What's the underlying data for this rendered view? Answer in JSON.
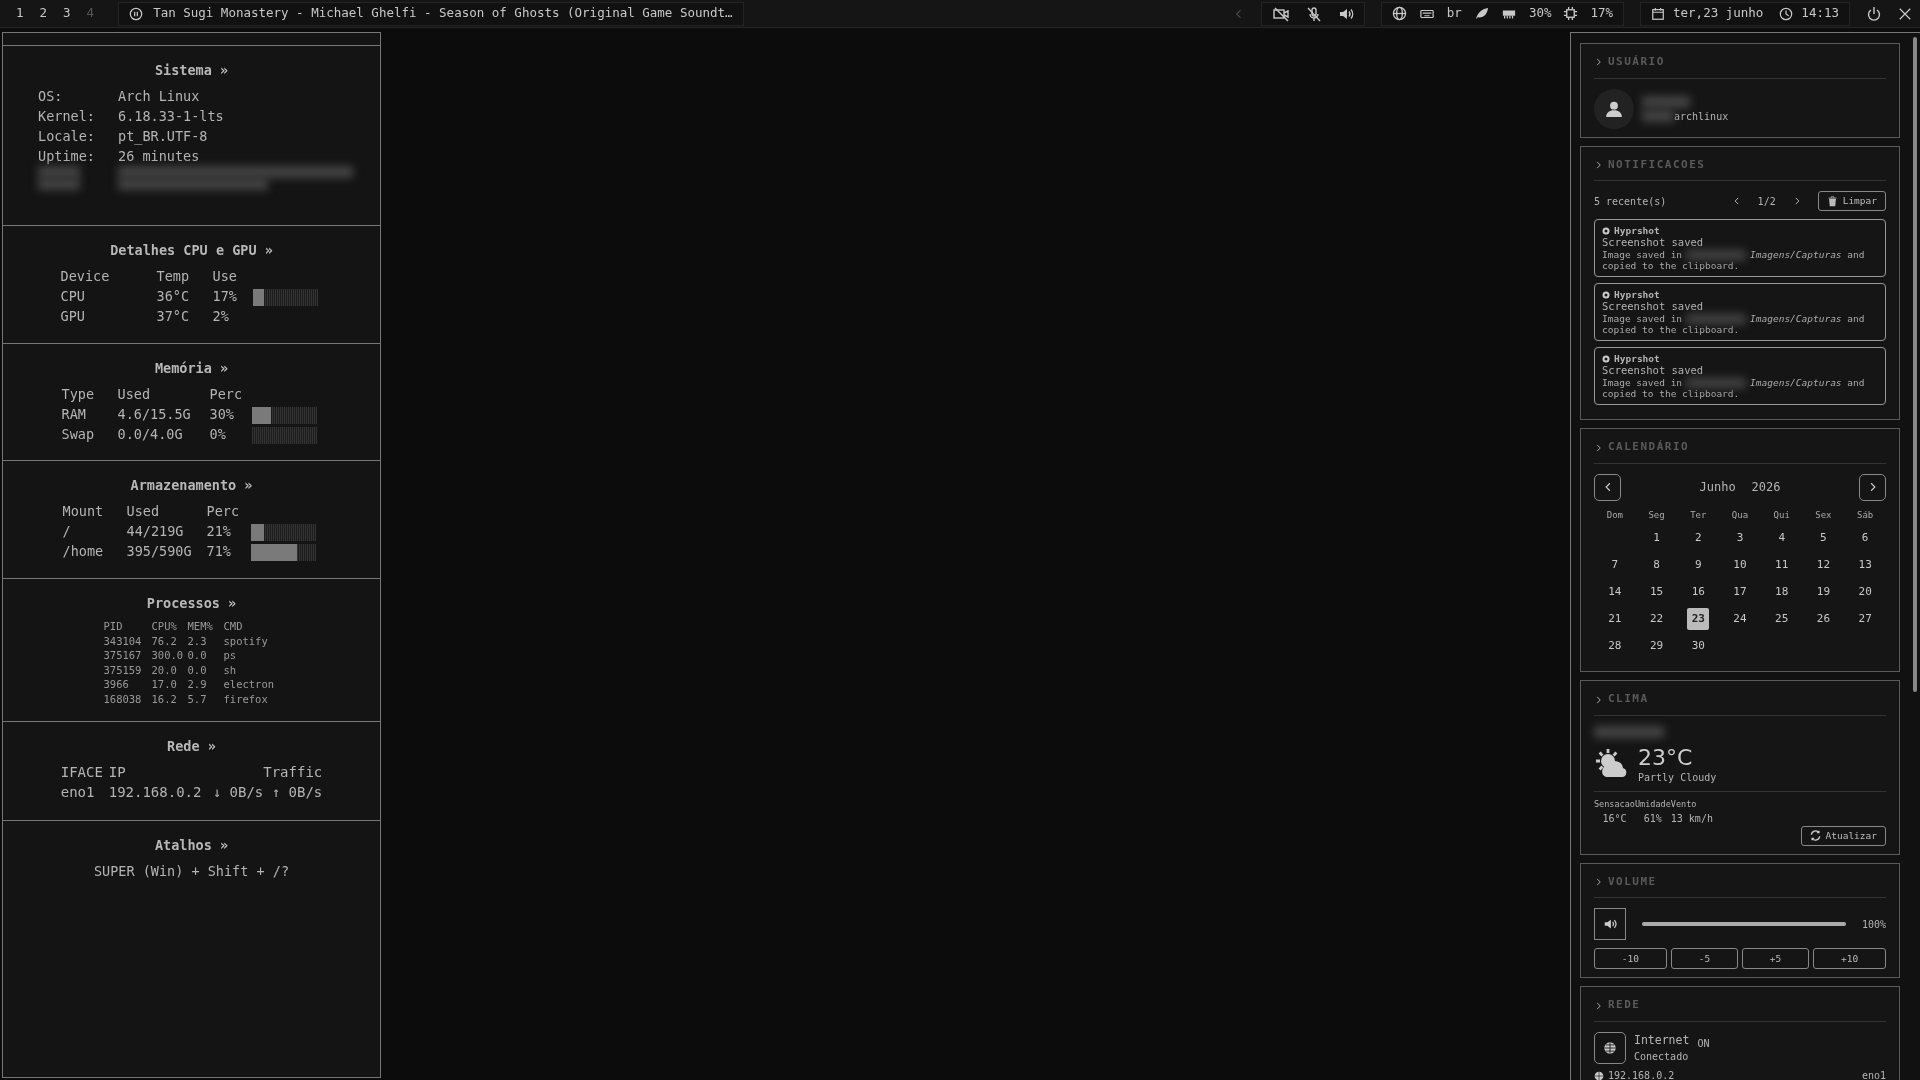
{
  "topbar": {
    "workspaces": [
      {
        "label": "1",
        "empty": false
      },
      {
        "label": "2",
        "empty": false
      },
      {
        "label": "3",
        "empty": false
      },
      {
        "label": "4",
        "empty": true
      }
    ],
    "media": {
      "title": "Tan Sugi Monastery - Michael Ghelfi - Season of Ghosts (Original Game Soundt…"
    },
    "camera_on": false,
    "mic_on": false,
    "keyboard": "br",
    "memory": "30%",
    "cpu": "17%",
    "date": "ter,23 junho",
    "time": "14:13"
  },
  "system": {
    "title": "Sistema »",
    "rows": [
      {
        "label": "OS:",
        "value": "Arch Linux"
      },
      {
        "label": "Kernel:",
        "value": "6.18.33-1-lts"
      },
      {
        "label": "Locale:",
        "value": "pt_BR.UTF-8"
      },
      {
        "label": "Uptime:",
        "value": "26 minutes"
      }
    ]
  },
  "cpu_gpu": {
    "title": "Detalhes CPU e GPU »",
    "columns": [
      "Device",
      "Temp",
      "Use"
    ],
    "rows": [
      {
        "cells": [
          "CPU",
          "36°C",
          "17%"
        ],
        "level": 0.17
      },
      {
        "cells": [
          "GPU",
          "37°C",
          "2%"
        ]
      }
    ]
  },
  "memory": {
    "title": "Memória »",
    "columns": [
      "Type",
      "Used",
      "Perc"
    ],
    "rows": [
      {
        "cells": [
          "RAM",
          "4.6/15.5G",
          "30%"
        ],
        "level": 0.3
      },
      {
        "cells": [
          "Swap",
          "0.0/4.0G",
          "0%"
        ],
        "level": 0
      }
    ]
  },
  "storage": {
    "title": "Armazenamento »",
    "columns": [
      "Mount",
      "Used",
      "Perc"
    ],
    "rows": [
      {
        "cells": [
          "/",
          "44/219G",
          "21%"
        ],
        "level": 0.21
      },
      {
        "cells": [
          "/home",
          "395/590G",
          "71%"
        ],
        "level": 0.71
      }
    ]
  },
  "processes": {
    "title": "Processos »",
    "columns": [
      "PID",
      "CPU%",
      "MEM%",
      "CMD"
    ],
    "rows": [
      [
        "343104",
        "76.2",
        "2.3",
        "spotify"
      ],
      [
        "375167",
        "300.0",
        "0.0",
        "ps"
      ],
      [
        "375159",
        "20.0",
        "0.0",
        "sh"
      ],
      [
        "3966",
        "17.0",
        "2.9",
        "electron"
      ],
      [
        "168038",
        "16.2",
        "5.7",
        "firefox"
      ]
    ]
  },
  "network": {
    "title": "Rede »",
    "columns": [
      "IFACE",
      "IP",
      "Traffic"
    ],
    "rows": [
      [
        "eno1",
        "192.168.0.2",
        "↓ 0B/s ↑ 0B/s"
      ]
    ]
  },
  "shortcuts": {
    "title": "Atalhos »",
    "text": "SUPER (Win) + Shift + /?"
  },
  "user": {
    "title": "USUÁRIO",
    "host": "archlinux"
  },
  "notifications": {
    "title": "NOTIFICACOES",
    "count": "5 recente(s)",
    "page": "1/2",
    "clear": "Limpar",
    "items": [
      {
        "app": "Hyprshot",
        "summary": "Screenshot saved",
        "body_start": "Image saved in",
        "body_mid": "*Imagens/Capturas* and",
        "body_end": "copied to the clipboard."
      },
      {
        "app": "Hyprshot",
        "summary": "Screenshot saved",
        "body_start": "Image saved in",
        "body_mid": "*Imagens/Capturas* and",
        "body_end": "copied to the clipboard."
      },
      {
        "app": "Hyprshot",
        "summary": "Screenshot saved",
        "body_start": "Image saved in",
        "body_mid": "*Imagens/Capturas* and",
        "body_end": "copied to the clipboard."
      }
    ]
  },
  "calendar": {
    "title": "CALENDÁRIO",
    "month": "Junho",
    "year": "2026",
    "weekdays": [
      "Dom",
      "Seg",
      "Ter",
      "Qua",
      "Qui",
      "Sex",
      "Sáb"
    ],
    "weeks": [
      [
        {
          "day": "1",
          "selected": false
        },
        {
          "day": "2",
          "selected": false
        },
        {
          "day": "3",
          "selected": false
        },
        {
          "day": "4",
          "selected": false
        },
        {
          "day": "5",
          "selected": false
        },
        {
          "day": "6",
          "selected": false
        }
      ],
      [
        {
          "day": "7",
          "selected": false
        },
        {
          "day": "8",
          "selected": false
        },
        {
          "day": "9",
          "selected": false
        },
        {
          "day": "10",
          "selected": false
        },
        {
          "day": "11",
          "selected": false
        },
        {
          "day": "12",
          "selected": false
        },
        {
          "day": "13",
          "selected": false
        }
      ],
      [
        {
          "day": "14",
          "selected": false
        },
        {
          "day": "15",
          "selected": false
        },
        {
          "day": "16",
          "selected": false
        },
        {
          "day": "17",
          "selected": false
        },
        {
          "day": "18",
          "selected": false
        },
        {
          "day": "19",
          "selected": false
        },
        {
          "day": "20",
          "selected": false
        }
      ],
      [
        {
          "day": "21",
          "selected": false
        },
        {
          "day": "22",
          "selected": false
        },
        {
          "day": "23",
          "selected": true
        },
        {
          "day": "24",
          "selected": false
        },
        {
          "day": "25",
          "selected": false
        },
        {
          "day": "26",
          "selected": false
        },
        {
          "day": "27",
          "selected": false
        }
      ],
      [
        {
          "day": "28",
          "selected": false
        },
        {
          "day": "29",
          "selected": false
        },
        {
          "day": "30",
          "selected": false
        }
      ]
    ]
  },
  "weather": {
    "title": "CLIMA",
    "temp": "23°C",
    "condition": "Partly Cloudy",
    "stats": [
      {
        "label": "Sensacao",
        "value": "16°C"
      },
      {
        "label": "Umidade",
        "value": "61%"
      },
      {
        "label": "Vento",
        "value": "13 km/h"
      }
    ],
    "refresh": "Atualizar"
  },
  "volume": {
    "title": "VOLUME",
    "level": 1.0,
    "reading": "100%",
    "steps": [
      "-10",
      "-5",
      "+5",
      "+10"
    ]
  },
  "net": {
    "title": "REDE",
    "name": "Internet",
    "status": "Conectado",
    "badge": "ON",
    "ip": "192.168.0.2",
    "iface": "eno1"
  }
}
